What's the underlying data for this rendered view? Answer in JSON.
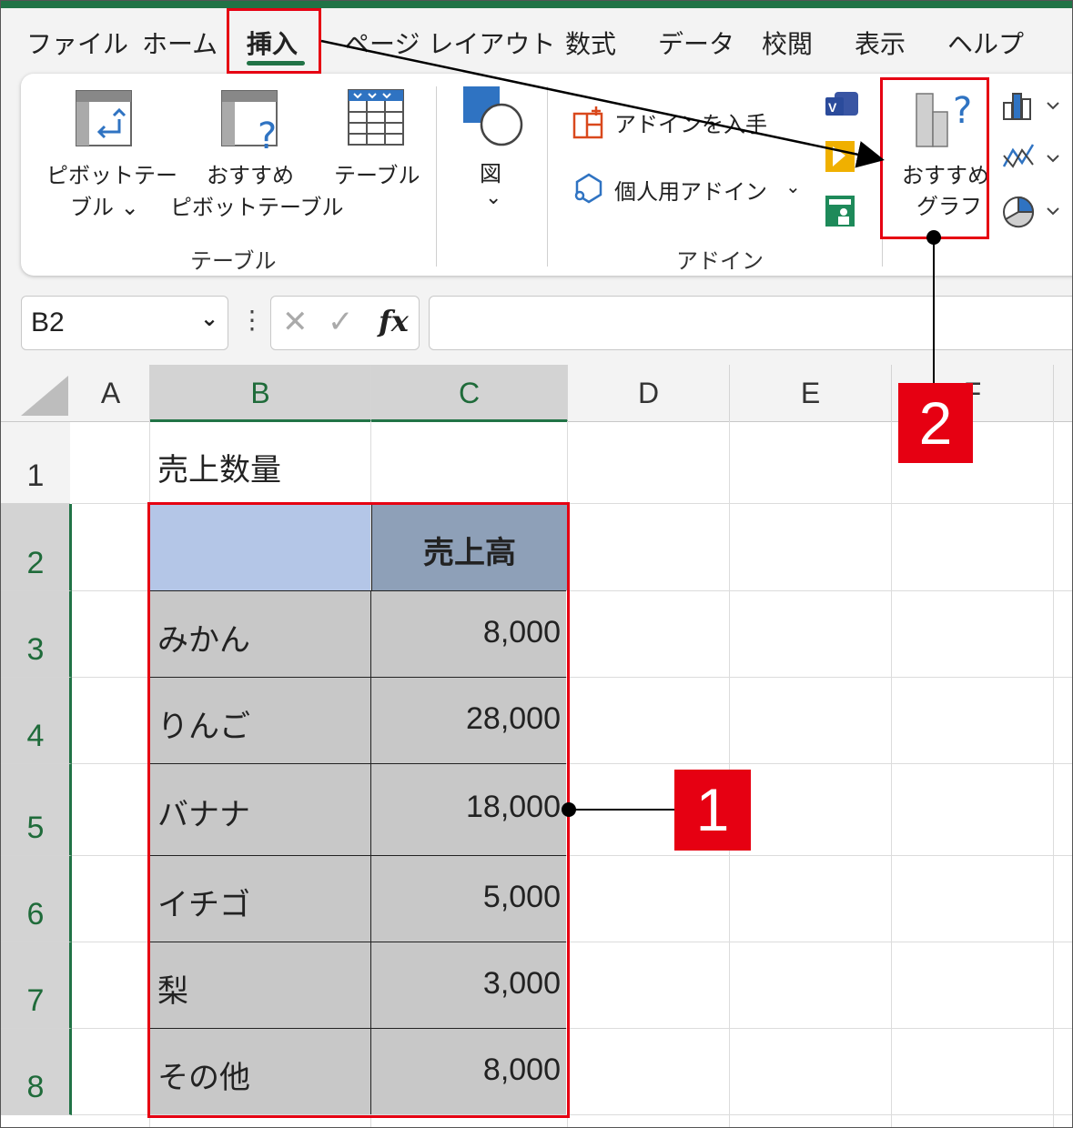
{
  "menu": {
    "tabs": [
      "ファイル",
      "ホーム",
      "挿入",
      "ページ レイアウト",
      "数式",
      "データ",
      "校閲",
      "表示",
      "ヘルプ"
    ],
    "active_tab": "挿入"
  },
  "ribbon": {
    "pivot_table": {
      "line1": "ピボットテー",
      "line2": "ブル ⌄"
    },
    "recommended_pivot": {
      "line1": "おすすめ",
      "line2": "ピボットテーブル"
    },
    "table": {
      "label": "テーブル"
    },
    "illustrations": {
      "label": "図",
      "chevron": "⌄"
    },
    "get_addins": {
      "label": "アドインを入手"
    },
    "personal_addins": {
      "label": "個人用アドイン",
      "chevron": "⌄"
    },
    "recommended_charts": {
      "line1": "おすすめ",
      "line2": "グラフ"
    },
    "groups": {
      "tables": "テーブル",
      "addins": "アドイン"
    },
    "icons": [
      "pivot-table-icon",
      "recommended-pivot-icon",
      "table-icon",
      "shapes-icon",
      "get-addins-icon",
      "personal-addins-icon",
      "visio-icon",
      "bing-maps-icon",
      "people-graph-icon",
      "recommended-charts-icon",
      "column-chart-icon",
      "line-chart-icon",
      "pie-chart-icon"
    ]
  },
  "formula_bar": {
    "name_box": "B2",
    "name_box_chevron": "⌄",
    "more": "⋮",
    "cancel": "✕",
    "enter": "✓",
    "fx": "fx",
    "value": ""
  },
  "sheet": {
    "columns": [
      "A",
      "B",
      "C",
      "D",
      "E",
      "F"
    ],
    "rows": [
      "1",
      "2",
      "3",
      "4",
      "5",
      "6",
      "7",
      "8"
    ],
    "title": "売上数量",
    "header": "売上高",
    "items": [
      {
        "name": "みかん",
        "value": "8,000"
      },
      {
        "name": "りんご",
        "value": "28,000"
      },
      {
        "name": "バナナ",
        "value": "18,000"
      },
      {
        "name": "イチゴ",
        "value": "5,000"
      },
      {
        "name": "梨",
        "value": "3,000"
      },
      {
        "name": "その他",
        "value": "8,000"
      }
    ]
  },
  "annotations": {
    "step1": "1",
    "step2": "2"
  },
  "colors": {
    "excel_green": "#217346",
    "annotation_red": "#e60012",
    "header_blank_fill": "#b4c6e7",
    "header_fill": "#8ea0b8",
    "selected_fill": "#c8c8c8"
  }
}
